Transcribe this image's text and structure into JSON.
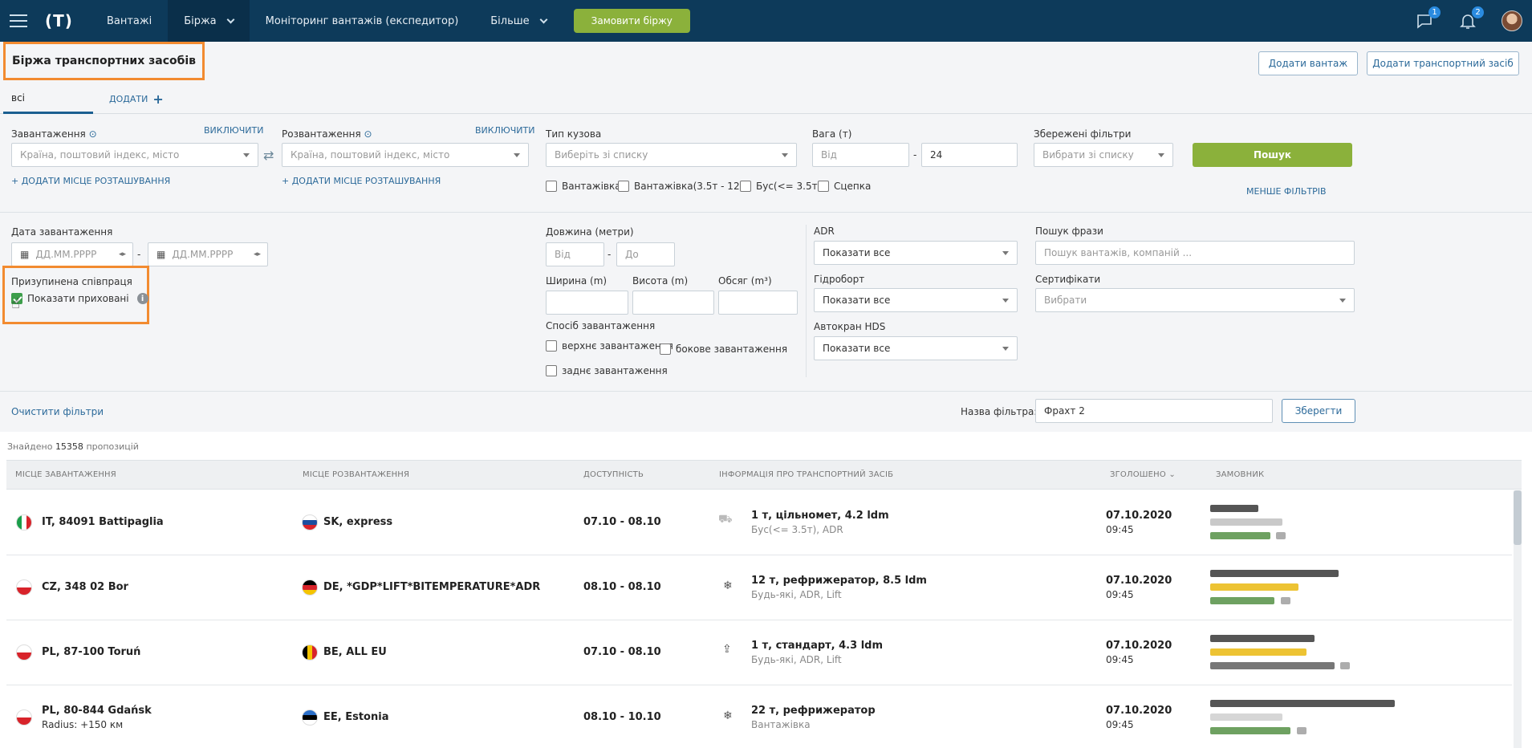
{
  "topbar": {
    "logo": "(T)",
    "nav": [
      "Вантажі",
      "Біржа",
      "Моніторинг вантажів (експедитор)",
      "Більше"
    ],
    "order_button": "Замовити біржу",
    "messages_count": "1",
    "notifications_count": "2"
  },
  "page": {
    "title": "Біржа транспортних засобів",
    "add_cargo": "Додати вантаж",
    "add_vehicle": "Додати транспортний засіб"
  },
  "tabs": {
    "all": "всі",
    "add": "ДОДАТИ"
  },
  "filters": {
    "loading_label": "Завантаження",
    "loading_toggle": "ВИКЛЮЧИТИ",
    "loading_placeholder": "Країна, поштовий індекс, місто",
    "loading_add": "+ ДОДАТИ МІСЦЕ РОЗТАШУВАННЯ",
    "unloading_label": "Розвантаження",
    "unloading_toggle": "ВИКЛЮЧИТИ",
    "unloading_placeholder": "Країна, поштовий індекс, місто",
    "unloading_add": "+ ДОДАТИ МІСЦЕ РОЗТАШУВАННЯ",
    "body_label": "Тип кузова",
    "body_placeholder": "Виберіть зі списку",
    "body_options": [
      "Вантажівка",
      "Вантажівка(3.5т - 12т)",
      "Бус(<= 3.5т)",
      "Сцепка"
    ],
    "weight_label": "Вага (т)",
    "weight_from_placeholder": "Від",
    "weight_to": "24",
    "saved_label": "Збережені фільтри",
    "saved_placeholder": "Вибрати зі списку",
    "search_button": "Пошук",
    "less_filters": "МЕНШЕ ФІЛЬТРІВ",
    "date_label": "Дата завантаження",
    "date_placeholder": "ДД.ММ.РРРР",
    "paused_label": "Призупинена співпраця",
    "show_hidden": "Показати приховані",
    "length_label": "Довжина (метри)",
    "length_from": "Від",
    "length_to": "До",
    "width_label": "Ширина (m)",
    "height_label": "Висота (m)",
    "volume_label": "Обсяг (m³)",
    "load_method_label": "Спосіб завантаження",
    "load_top": "верхнє завантаження",
    "load_side": "бокове завантаження",
    "load_rear": "заднє завантаження",
    "adr_label": "ADR",
    "adr_value": "Показати все",
    "hydro_label": "Гідроборт",
    "hydro_value": "Показати все",
    "crane_label": "Автокран HDS",
    "crane_value": "Показати все",
    "phrase_label": "Пошук фрази",
    "phrase_placeholder": "Пошук вантажів, компаній ...",
    "cert_label": "Сертифікати",
    "cert_placeholder": "Вибрати",
    "clear": "Очистити фільтри",
    "filter_name_label": "Назва фільтра:",
    "filter_name_value": "Фрахт 2",
    "save_button": "Зберегти"
  },
  "results": {
    "found_prefix": "Знайдено",
    "found_count": "15358",
    "found_suffix": "пропозицій",
    "columns": [
      "Місце завантаження",
      "Місце розвантаження",
      "Доступність",
      "Інформація про транспортний засіб",
      "Зголошено",
      "Замовник"
    ],
    "rows": [
      {
        "from": "IT, 84091 Battipaglia",
        "from_sub": "",
        "to": "SK, express",
        "avail": "07.10 - 08.10",
        "info": "1 т, цільномет, 4.2 ldm",
        "info_sub": "Бус(<= 3.5т), ADR",
        "date": "07.10.2020",
        "time": "09:45",
        "icon": "van-icon"
      },
      {
        "from": "CZ, 348 02 Bor",
        "from_sub": "",
        "to": "DE, *GDP*LIFT*BITEMPERATURE*ADR",
        "avail": "08.10 - 08.10",
        "info": "12 т, рефрижератор, 8.5 ldm",
        "info_sub": "Будь-які, ADR, Lift",
        "date": "07.10.2020",
        "time": "09:45",
        "icon": "snowflake-icon"
      },
      {
        "from": "PL, 87-100 Toruń",
        "from_sub": "",
        "to": "BE, ALL EU",
        "avail": "07.10 - 08.10",
        "info": "1 т, стандарт, 4.3 ldm",
        "info_sub": "Будь-які, ADR, Lift",
        "date": "07.10.2020",
        "time": "09:45",
        "icon": "upload-icon"
      },
      {
        "from": "PL, 80-844 Gdańsk",
        "from_sub": "Radius: +150 км",
        "to": "EE, Estonia",
        "avail": "08.10 - 10.10",
        "info": "22 т, рефрижератор",
        "info_sub": "Вантажівка",
        "date": "07.10.2020",
        "time": "09:45",
        "icon": "snowflake-icon"
      }
    ]
  }
}
